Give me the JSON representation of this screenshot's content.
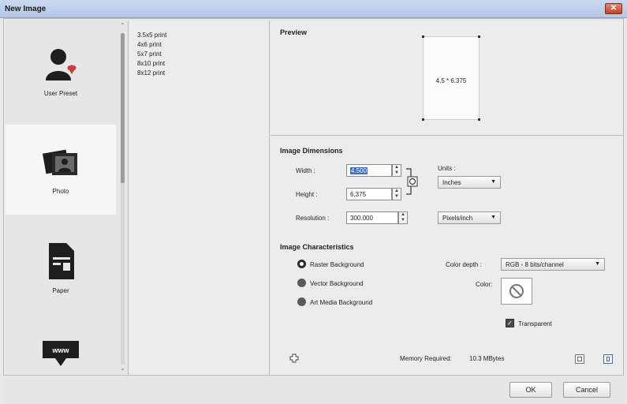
{
  "window": {
    "title": "New Image",
    "close_label": "✕"
  },
  "categories": [
    {
      "label": "User Preset",
      "icon": "user-preset-icon",
      "selected": false
    },
    {
      "label": "Photo",
      "icon": "photo-icon",
      "selected": true
    },
    {
      "label": "Paper",
      "icon": "paper-icon",
      "selected": false
    },
    {
      "label": "",
      "icon": "web-display-icon",
      "selected": false
    }
  ],
  "presets": [
    "3.5x5 print",
    "4x6 print",
    "5x7 print",
    "8x10 print",
    "8x12 print"
  ],
  "preview": {
    "title": "Preview",
    "size_text": "4.5 * 6.375"
  },
  "dimensions": {
    "title": "Image Dimensions",
    "width_label": "Width :",
    "width_value": "4.500",
    "height_label": "Height :",
    "height_value": "6.375",
    "resolution_label": "Resolution :",
    "resolution_value": "300.000",
    "units_label": "Units :",
    "units_value": "Inches",
    "resolution_units_value": "Pixels/inch"
  },
  "characteristics": {
    "title": "Image Characteristics",
    "raster_label": "Raster Background",
    "vector_label": "Vector Background",
    "art_media_label": "Art Media Background",
    "color_depth_label": "Color depth :",
    "color_depth_value": "RGB - 8 bits/channel",
    "color_label": "Color:",
    "transparent_label": "Transparent"
  },
  "memory": {
    "label": "Memory Required:",
    "value": "10.3 MBytes"
  },
  "buttons": {
    "ok": "OK",
    "cancel": "Cancel"
  },
  "colors": {
    "selection": "#3a6fc4",
    "titlebar": "#b4c8e4",
    "close": "#c0432a"
  }
}
